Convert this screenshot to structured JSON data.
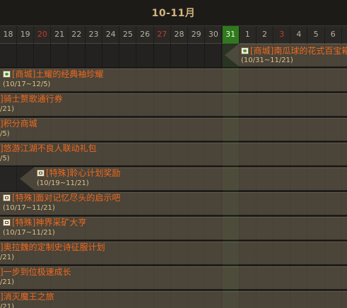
{
  "calendar": {
    "month_label": "10-11月",
    "days": [
      {
        "label": "18",
        "weekend": false,
        "today": false
      },
      {
        "label": "19",
        "weekend": false,
        "today": false
      },
      {
        "label": "20",
        "weekend": true,
        "today": false
      },
      {
        "label": "21",
        "weekend": false,
        "today": false
      },
      {
        "label": "22",
        "weekend": false,
        "today": false
      },
      {
        "label": "23",
        "weekend": false,
        "today": false
      },
      {
        "label": "24",
        "weekend": false,
        "today": false
      },
      {
        "label": "25",
        "weekend": false,
        "today": false
      },
      {
        "label": "26",
        "weekend": false,
        "today": false
      },
      {
        "label": "27",
        "weekend": true,
        "today": false
      },
      {
        "label": "28",
        "weekend": false,
        "today": false
      },
      {
        "label": "29",
        "weekend": false,
        "today": false
      },
      {
        "label": "30",
        "weekend": false,
        "today": false
      },
      {
        "label": "31",
        "weekend": false,
        "today": true
      },
      {
        "label": "1",
        "weekend": false,
        "today": false
      },
      {
        "label": "2",
        "weekend": false,
        "today": false
      },
      {
        "label": "3",
        "weekend": true,
        "today": false
      },
      {
        "label": "4",
        "weekend": false,
        "today": false
      },
      {
        "label": "5",
        "weekend": false,
        "today": false
      },
      {
        "label": "6",
        "weekend": false,
        "today": false
      }
    ]
  },
  "events": [
    {
      "icon": "shop-icon",
      "title": "[商城]南瓜球的花式百宝箱",
      "date": "(10/31~11/21)"
    },
    {
      "icon": "shop-icon",
      "title": "[商城]土耀的经典袖珍耀",
      "date": "(10/17~12/5)"
    },
    {
      "icon": "",
      "title": "]骑士赘歌通行券",
      "date": "/21)"
    },
    {
      "icon": "",
      "title": "]积分商城",
      "date": "/5)"
    },
    {
      "icon": "",
      "title": "]悠游江湖不良人联动礼包",
      "date": "/5)"
    },
    {
      "icon": "special-icon",
      "title": "[特殊]聆心计划奖励",
      "date": "(10/19~11/21)"
    },
    {
      "icon": "special-icon",
      "title": "[特殊]面对记忆尽头的启示吧",
      "date": "(10/17~11/21)"
    },
    {
      "icon": "special-icon",
      "title": "[特殊]神界采矿大亨",
      "date": "(10/17~11/21)"
    },
    {
      "icon": "",
      "title": "]奥拉魏的定制史诗征服计划",
      "date": "/21)"
    },
    {
      "icon": "",
      "title": "]一步到位极速成长",
      "date": "/21)"
    },
    {
      "icon": "",
      "title": "]消灭魔王之旅",
      "date": "/21)"
    }
  ]
}
